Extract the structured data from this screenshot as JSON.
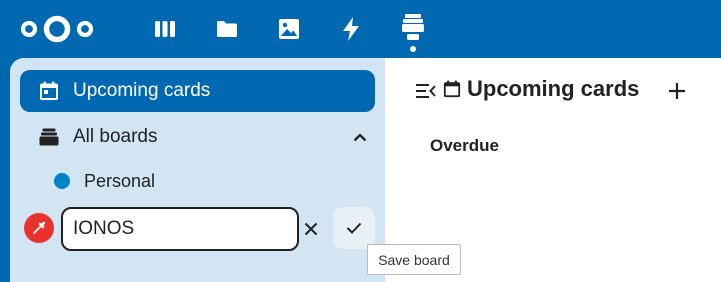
{
  "header": {
    "logo_icon": "nextcloud-logo",
    "apps": [
      {
        "icon": "dashboard-icon",
        "name": "dashboard"
      },
      {
        "icon": "folder-icon",
        "name": "files"
      },
      {
        "icon": "image-icon",
        "name": "photos"
      },
      {
        "icon": "activity-icon",
        "name": "activity"
      },
      {
        "icon": "deck-icon",
        "name": "deck",
        "active": true
      }
    ]
  },
  "sidebar": {
    "upcoming_label": "Upcoming cards",
    "all_boards_label": "All boards",
    "boards": [
      {
        "label": "Personal",
        "color": "#0082c9"
      }
    ],
    "new_board": {
      "value": "IONOS",
      "color": "#e9322d"
    }
  },
  "main": {
    "title": "Upcoming cards",
    "sections": [
      "Overdue"
    ]
  },
  "tooltip": {
    "text": "Save board"
  },
  "colors": {
    "brand": "#0068b0",
    "sidebar_bg": "#d1e5f3",
    "board_personal": "#0082c9",
    "picker_red": "#e9322d"
  }
}
